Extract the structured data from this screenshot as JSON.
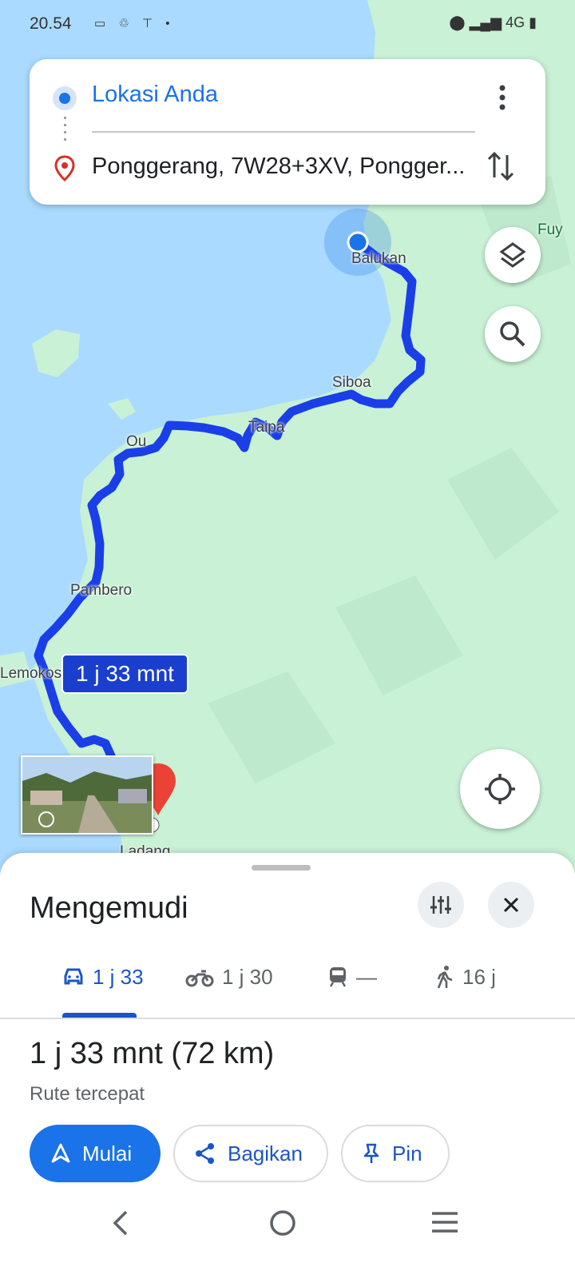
{
  "status_bar": {
    "time": "20.54",
    "notifications": "▭ ♲ ⊤ •",
    "right_icons": "4G"
  },
  "search_card": {
    "origin": "Lokasi Anda",
    "destination": "Ponggerang, 7W28+3XV, Pongger..."
  },
  "map": {
    "labels": {
      "fuy": "Fuy",
      "balukan": "Balukan",
      "siboa": "Siboa",
      "taipa": "Taipa",
      "ou": "Ou",
      "pambero": "Pambero",
      "lemokos": "Lemokos",
      "ladang": "Ladang"
    },
    "eta_badge": "1 j 33 mnt",
    "colors": {
      "water": "#aadaff",
      "land": "#c8f1d5",
      "route": "#1a3fe8"
    }
  },
  "sheet": {
    "title": "Mengemudi",
    "tabs": [
      {
        "icon": "car-icon",
        "label": "1 j 33"
      },
      {
        "icon": "motorcycle-icon",
        "label": "1 j 30"
      },
      {
        "icon": "transit-icon",
        "label": "—"
      },
      {
        "icon": "walk-icon",
        "label": "16 j"
      }
    ],
    "route_time": "1 j 33 mnt (72 km)",
    "route_subtitle": "Rute tercepat",
    "buttons": {
      "start": "Mulai",
      "share": "Bagikan",
      "pin": "Pin"
    }
  }
}
